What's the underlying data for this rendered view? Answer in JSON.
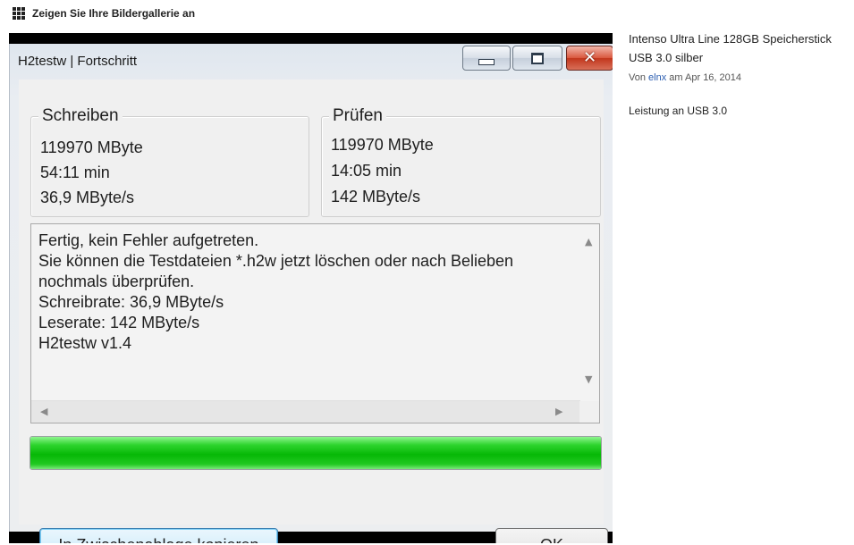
{
  "gallery": {
    "link_text": "Zeigen Sie Ihre Bildergallerie an",
    "icon": "grid-icon"
  },
  "window": {
    "title": "H2testw | Fortschritt",
    "controls": {
      "minimize": "minimize-icon",
      "maximize": "maximize-icon",
      "close_glyph": "✕"
    },
    "write_group": {
      "legend": "Schreiben",
      "size": "119970 MByte",
      "time": "54:11 min",
      "speed": "36,9 MByte/s"
    },
    "verify_group": {
      "legend": "Prüfen",
      "size": "119970 MByte",
      "time": "14:05 min",
      "speed": "142 MByte/s"
    },
    "log_text": "Fertig, kein Fehler aufgetreten.\nSie können die Testdateien *.h2w jetzt löschen oder nach Belieben nochmals überprüfen.\nSchreibrate: 36,9 MByte/s\nLeserate: 142 MByte/s\nH2testw v1.4",
    "progress_percent": 100,
    "copy_button": "In Zwischenablage kopieren",
    "ok_button": "OK",
    "colors": {
      "progress": "#06b806",
      "close": "#c2361c"
    }
  },
  "product": {
    "title": "Intenso Ultra Line 128GB Speicherstick USB 3.0 silber",
    "by_label": "Von",
    "user": "elnx",
    "date_prefix": "am",
    "date": "Apr 16, 2014",
    "caption": "Leistung an USB 3.0"
  }
}
